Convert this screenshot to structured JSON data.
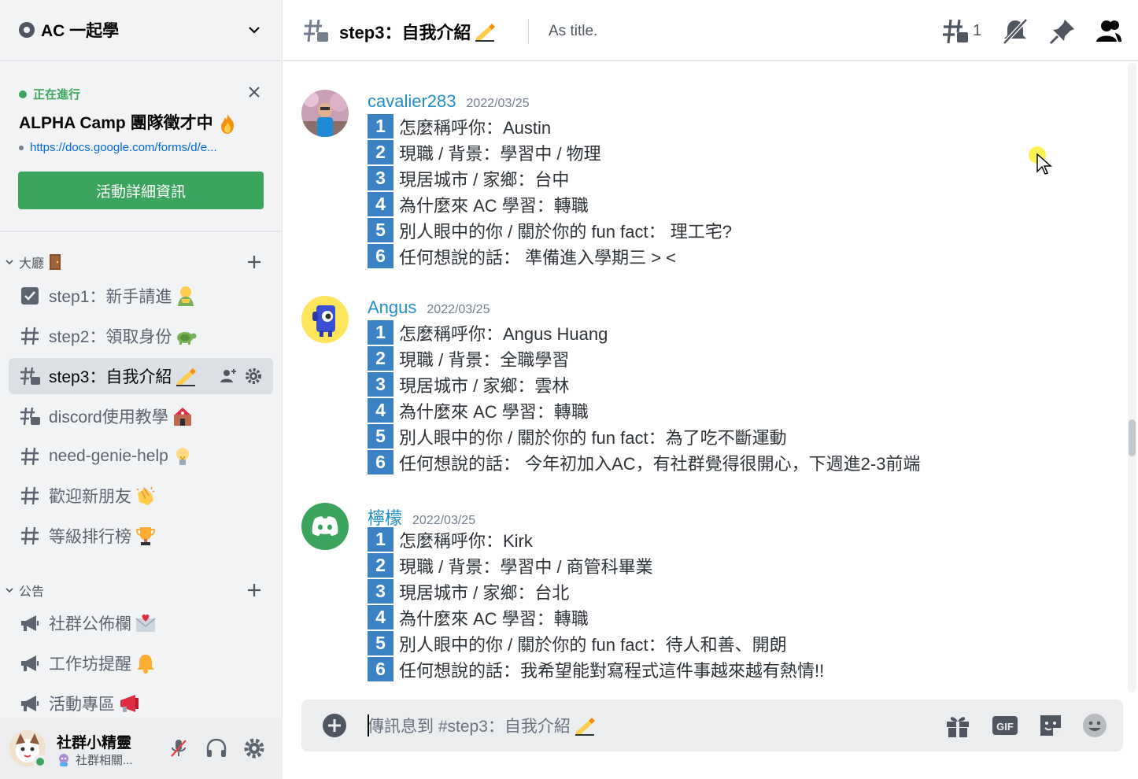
{
  "server": {
    "name": "AC 一起學"
  },
  "event": {
    "status": "正在進行",
    "title": "ALPHA Camp 團隊徵才中",
    "link": "https://docs.google.com/forms/d/e...",
    "button": "活動詳細資訊"
  },
  "categories": [
    {
      "name": "大廳",
      "emoji": "door"
    },
    {
      "name": "公告",
      "emoji": ""
    }
  ],
  "channels": [
    {
      "label": "step1：新手請進",
      "icon": "rules-checkbox-icon",
      "emoji": "person-bowing"
    },
    {
      "label": "step2：領取身份",
      "icon": "hash-icon",
      "emoji": "turtle"
    },
    {
      "label": "step3：自我介紹",
      "icon": "threads-icon",
      "emoji": "writing-hand",
      "active": true
    },
    {
      "label": "discord使用教學",
      "icon": "threads-icon",
      "emoji": "school"
    },
    {
      "label": "need-genie-help",
      "icon": "hash-icon",
      "emoji": "light-bulb"
    },
    {
      "label": "歡迎新朋友",
      "icon": "hash-icon",
      "emoji": "clapping-hands"
    },
    {
      "label": "等級排行榜",
      "icon": "hash-icon",
      "emoji": "trophy"
    },
    {
      "label": "社群公佈欄",
      "icon": "announcement-icon",
      "emoji": "love-letter"
    },
    {
      "label": "工作坊提醒",
      "icon": "announcement-icon",
      "emoji": "bell"
    },
    {
      "label": "活動專區",
      "icon": "announcement-icon",
      "emoji": "megaphone"
    }
  ],
  "user": {
    "name": "社群小精靈",
    "status": "社群相關..."
  },
  "header": {
    "channel": "step3：自我介紹",
    "topic": "As title.",
    "thread_count": "1"
  },
  "messages": [
    {
      "author": "cavalier283",
      "date": "2022/03/25",
      "lines": [
        "怎麼稱呼你：Austin",
        "現職 / 背景：學習中 / 物理",
        "現居城市 / 家鄉：台中",
        "為什麼來 AC 學習：轉職",
        "別人眼中的你 / 關於你的 fun fact： 理工宅?",
        "任何想說的話： 準備進入學期三 > <"
      ]
    },
    {
      "author": "Angus",
      "date": "2022/03/25",
      "lines": [
        "怎麼稱呼你：Angus Huang",
        "現職 / 背景：全職學習",
        "現居城市 / 家鄉：雲林",
        "為什麼來 AC 學習：轉職",
        "別人眼中的你 / 關於你的 fun fact：為了吃不斷運動",
        "任何想說的話： 今年初加入AC，有社群覺得很開心，下週進2-3前端"
      ]
    },
    {
      "author": "檸檬",
      "date": "2022/03/25",
      "lines": [
        "怎麼稱呼你：Kirk",
        "現職 / 背景：學習中 / 商管科畢業",
        "現居城市 / 家鄉：台北",
        "為什麼來 AC 學習：轉職",
        "別人眼中的你 / 關於你的 fun fact：待人和善、開朗",
        "任何想說的話：我希望能對寫程式這件事越來越有熱情!!"
      ]
    }
  ],
  "numbers": [
    "1",
    "2",
    "3",
    "4",
    "5",
    "6"
  ],
  "composer": {
    "placeholder": "傳訊息到 #step3：自我介紹"
  },
  "colors": {
    "accent": "#3ba55d",
    "link": "#1f8ec9",
    "number_badge": "#3a82c4"
  }
}
